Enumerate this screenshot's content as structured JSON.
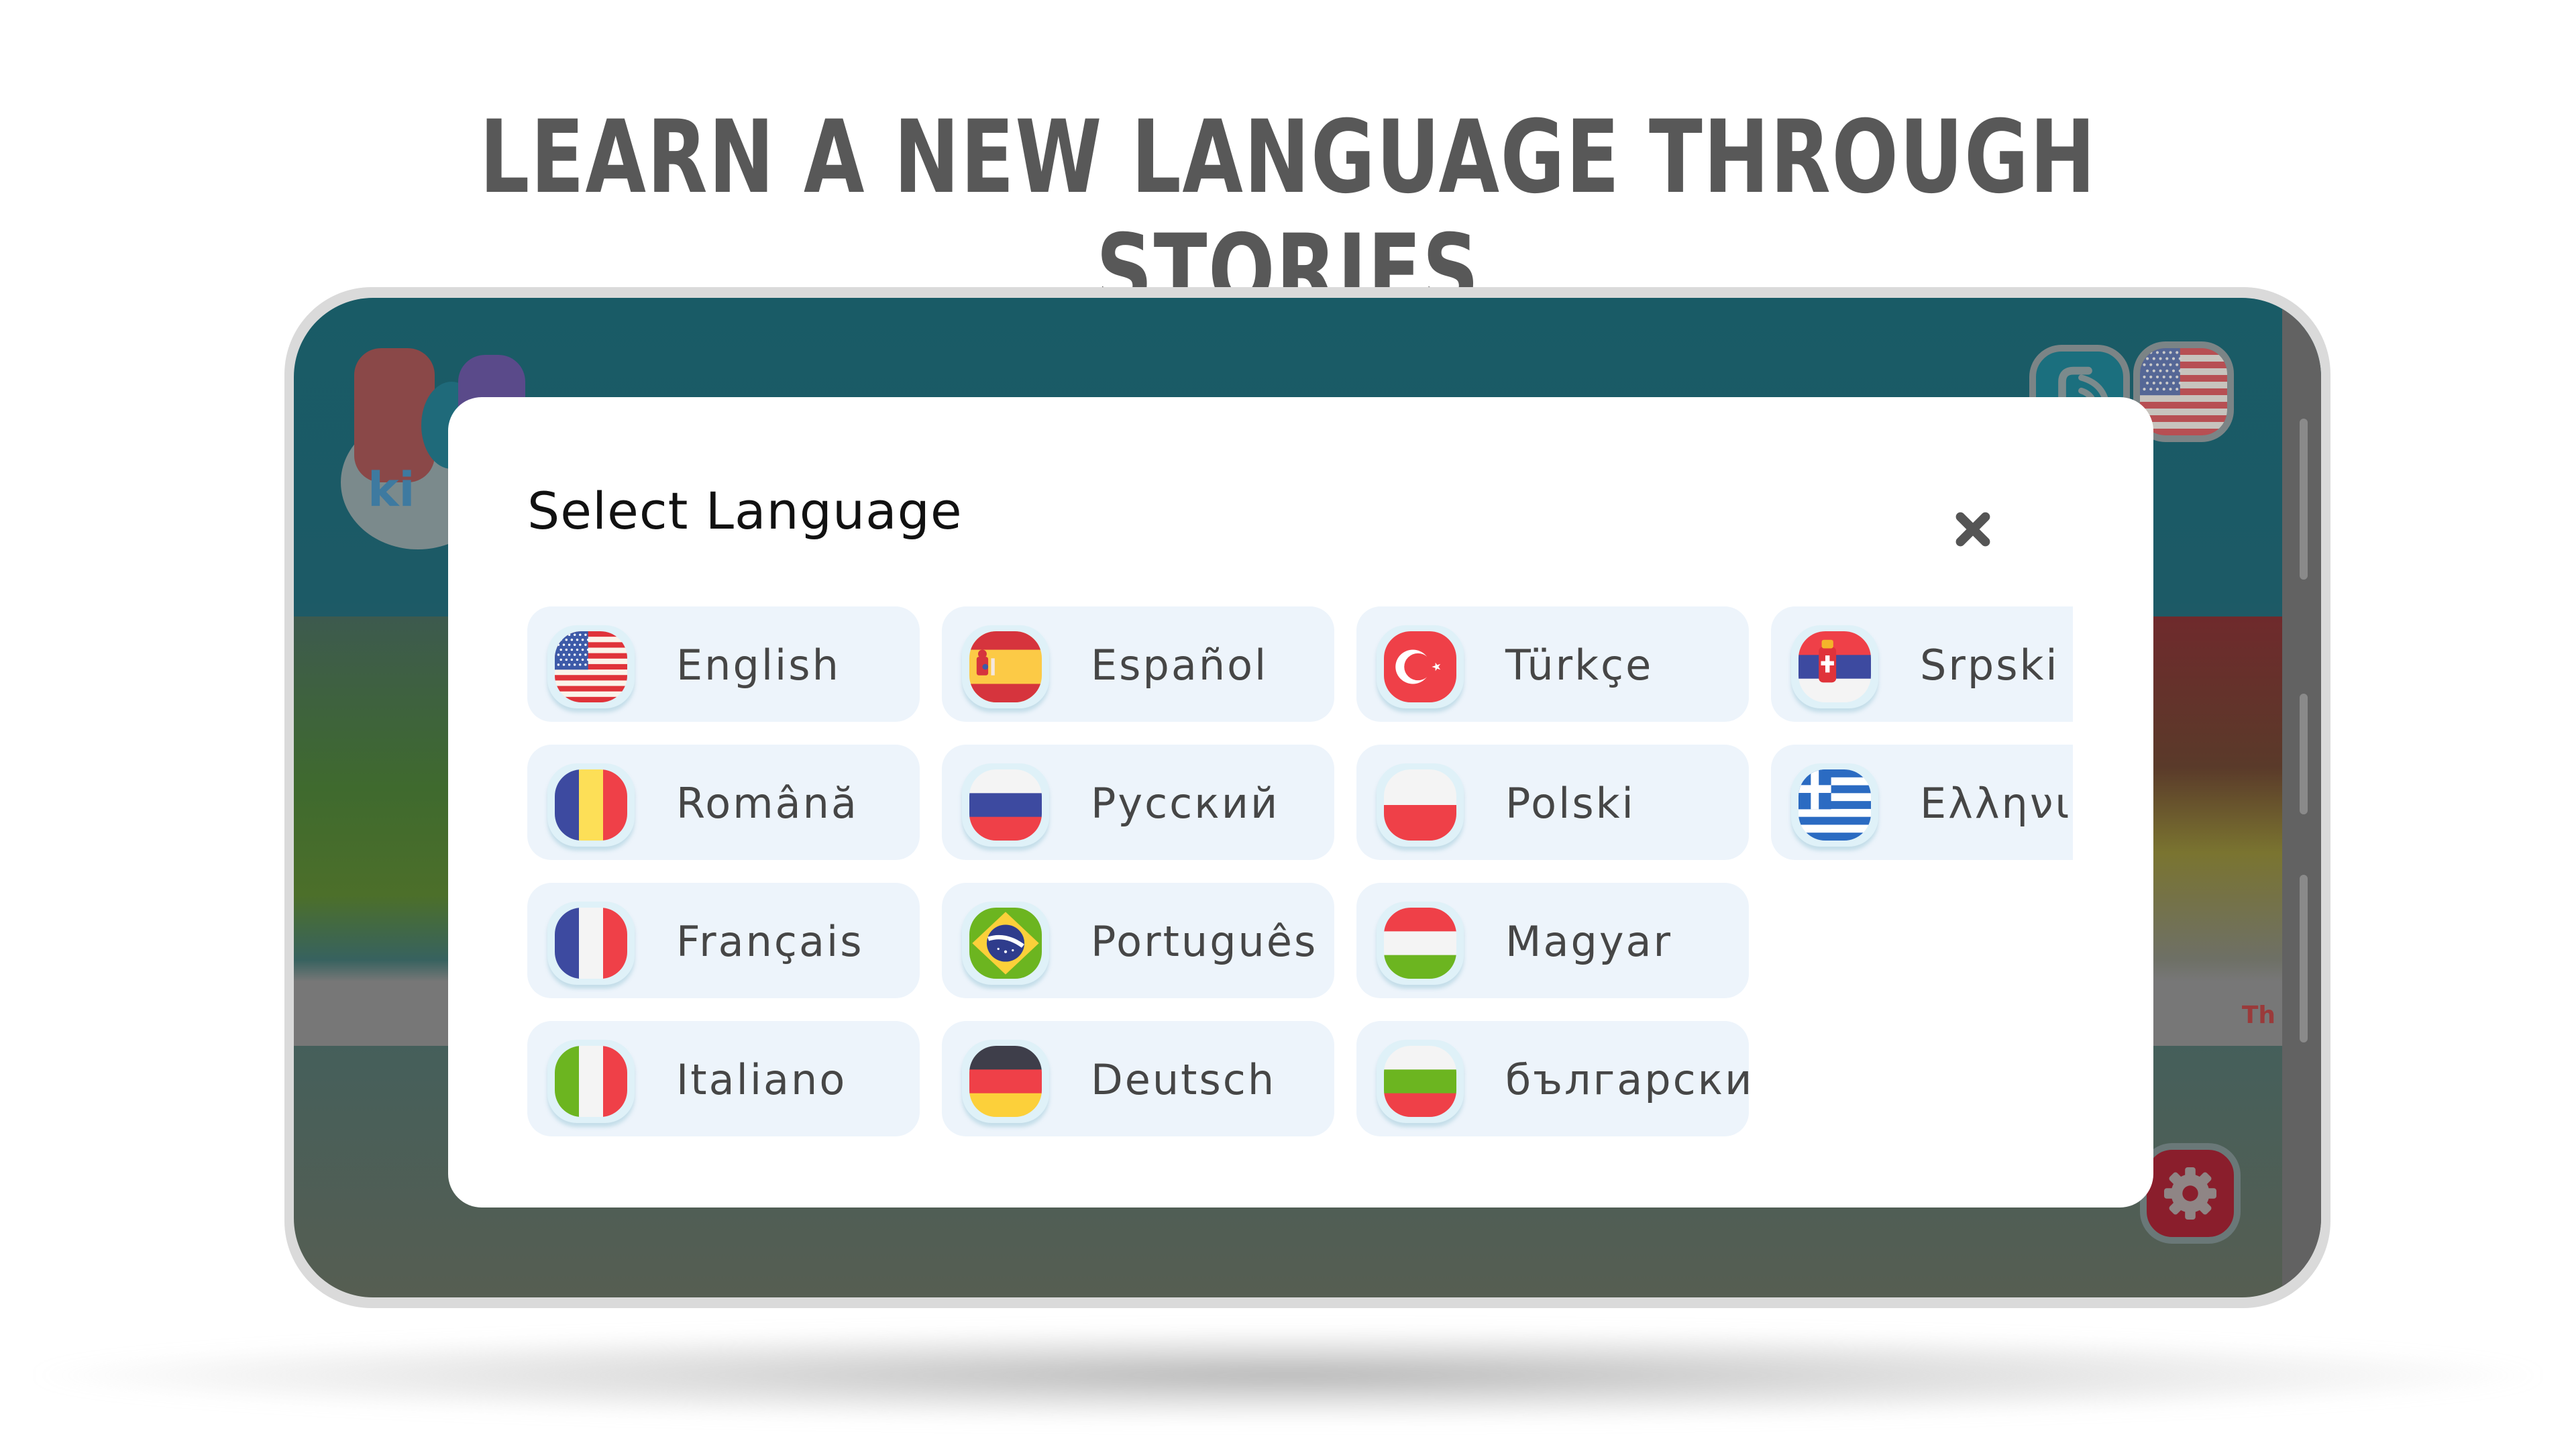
{
  "headline": "LEARN A NEW LANGUAGE THROUGH STORIES",
  "app": {
    "logo_text": "ki",
    "top_icons": [
      {
        "name": "audio-icon"
      },
      {
        "name": "us-flag-icon",
        "label": "Current language flag"
      }
    ],
    "settings_icon": "gear-icon",
    "story_caption_right": "Th"
  },
  "modal": {
    "title": "Select Language",
    "close_icon": "close-icon",
    "languages": [
      {
        "label": "English",
        "flag": "us"
      },
      {
        "label": "Español",
        "flag": "es"
      },
      {
        "label": "Türkçe",
        "flag": "tr"
      },
      {
        "label": "Srpski",
        "flag": "rs"
      },
      {
        "label": "Română",
        "flag": "ro"
      },
      {
        "label": "Русский",
        "flag": "ru"
      },
      {
        "label": "Polski",
        "flag": "pl"
      },
      {
        "label": "Ελληνικά",
        "flag": "gr"
      },
      {
        "label": "Français",
        "flag": "fr"
      },
      {
        "label": "Português",
        "flag": "br"
      },
      {
        "label": "Magyar",
        "flag": "hu"
      },
      {
        "label": "Italiano",
        "flag": "it"
      },
      {
        "label": "Deutsch",
        "flag": "de"
      },
      {
        "label": "български",
        "flag": "bg"
      }
    ]
  },
  "colors": {
    "card_bg": "#edf4fb",
    "label_text": "#464646",
    "title_text": "#111111",
    "close_icon": "#555555",
    "headline": "#585858"
  }
}
